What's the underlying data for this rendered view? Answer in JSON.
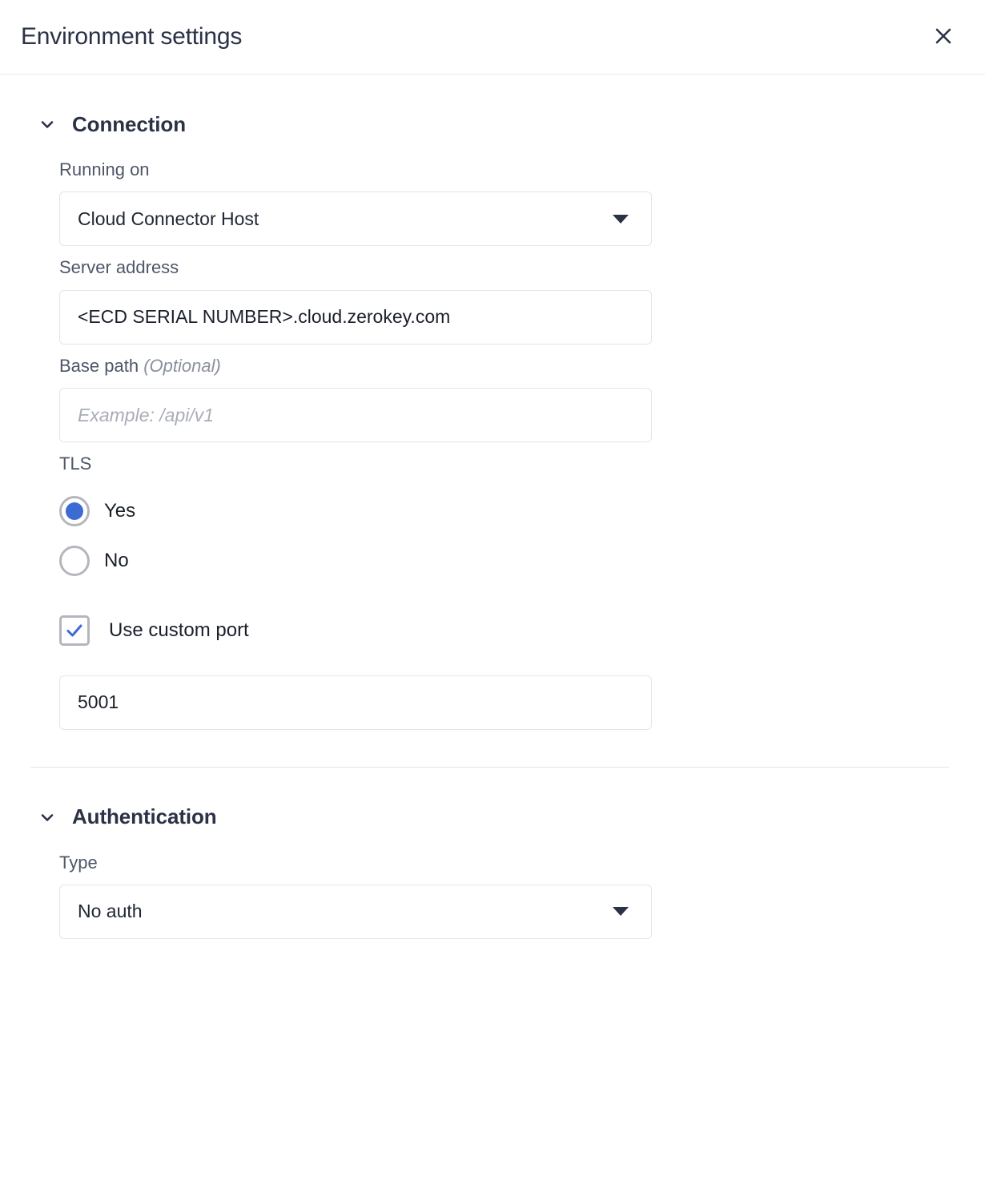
{
  "header": {
    "title": "Environment settings",
    "close_label": "Close",
    "close_icon": "close-icon"
  },
  "sections": [
    {
      "id": "connection",
      "title": "Connection",
      "expanded": true,
      "chevron_icon": "chevron-down-icon"
    },
    {
      "id": "authentication",
      "title": "Authentication",
      "expanded": true,
      "chevron_icon": "chevron-down-icon"
    }
  ],
  "connection": {
    "running_on": {
      "label": "Running on",
      "value": "Cloud Connector Host",
      "caret_icon": "caret-down-icon"
    },
    "server_address": {
      "label": "Server address",
      "value": "<ECD SERIAL NUMBER>.cloud.zerokey.com",
      "placeholder": ""
    },
    "base_path": {
      "label": "Base path",
      "label_optional": "(Optional)",
      "value": "",
      "placeholder": "Example: /api/v1"
    },
    "tls": {
      "label": "TLS",
      "selected": "Yes",
      "options": [
        {
          "label": "Yes",
          "checked": true
        },
        {
          "label": "No",
          "checked": false
        }
      ]
    },
    "custom_port": {
      "label": "Use custom port",
      "checked": true,
      "check_icon": "check-icon",
      "port_value": "5001",
      "port_placeholder": ""
    }
  },
  "authentication": {
    "type": {
      "label": "Type",
      "value": "No auth",
      "caret_icon": "caret-down-icon"
    }
  },
  "colors": {
    "accent": "#3c6bd4",
    "title": "#2b3246",
    "label": "#4e5668",
    "border": "#e4e5ea",
    "divider": "#e4e5ec",
    "placeholder": "#a9adb9"
  }
}
